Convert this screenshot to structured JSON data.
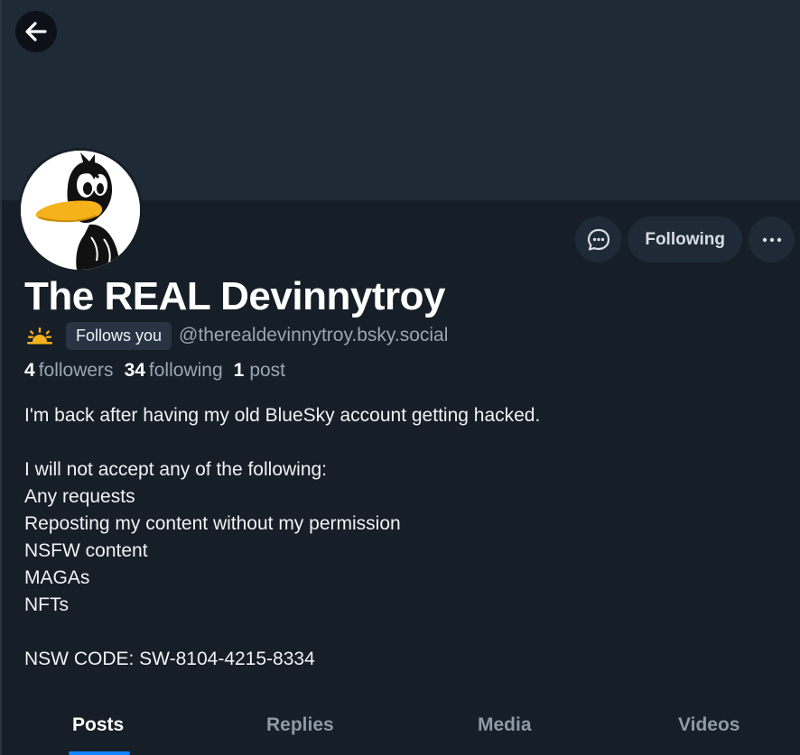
{
  "profile": {
    "display_name": "The REAL Devinnytroy",
    "follows_you_badge": "Follows you",
    "handle": "@therealdevinnytroy.bsky.social",
    "avatar_icon": "duck-avatar-icon"
  },
  "actions": {
    "message_icon": "chat-bubble-icon",
    "following_label": "Following",
    "more_icon": "ellipsis-icon"
  },
  "stats": {
    "followers_count": "4",
    "followers_label": "followers",
    "following_count": "34",
    "following_label": "following",
    "posts_count": "1",
    "posts_label": "post"
  },
  "bio": {
    "lines": [
      "I'm back after having my old BlueSky account getting hacked.",
      "",
      "I will not accept any of the following:",
      "Any requests",
      "Reposting my content without my permission",
      "NSFW content",
      "MAGAs",
      "NFTs",
      "",
      "NSW CODE: SW-8104-4215-8334"
    ]
  },
  "tabs": [
    {
      "label": "Posts",
      "active": true
    },
    {
      "label": "Replies",
      "active": false
    },
    {
      "label": "Media",
      "active": false
    },
    {
      "label": "Videos",
      "active": false
    }
  ],
  "colors": {
    "background": "#161e27",
    "banner": "#1f2a37",
    "accent": "#1083fe",
    "muted_text": "#9aa6b2",
    "sun": "#f5b21a"
  }
}
